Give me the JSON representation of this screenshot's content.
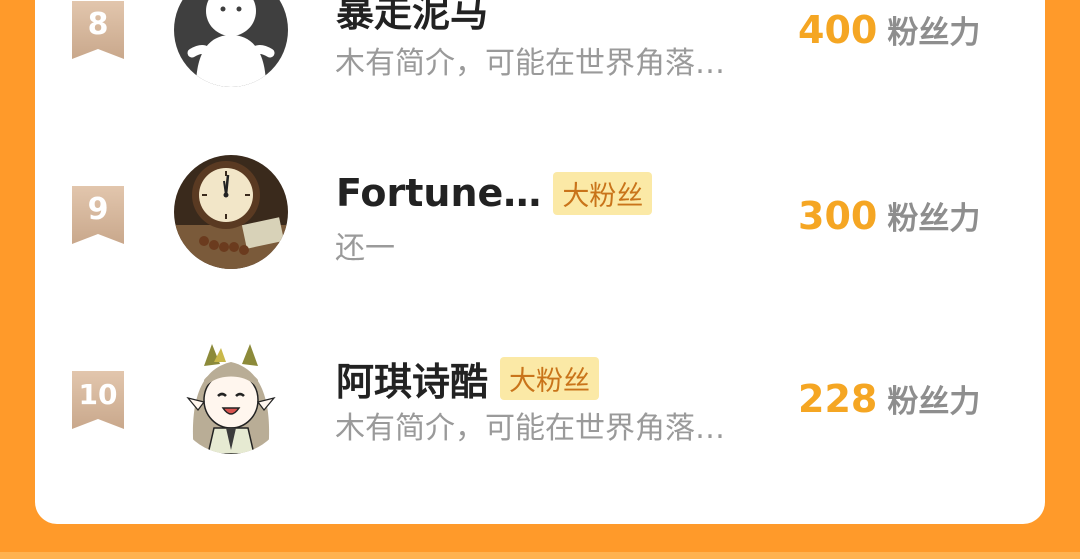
{
  "ranking": {
    "rows": [
      {
        "rank": "8",
        "name": "暴走泥马",
        "bio": "木有简介，可能在世界角落…",
        "score": "400",
        "score_unit": "粉丝力",
        "badge": "",
        "avatar_icon": "default-person-avatar"
      },
      {
        "rank": "9",
        "name": "Fortune…",
        "bio": "还一",
        "score": "300",
        "score_unit": "粉丝力",
        "badge": "大粉丝",
        "avatar_icon": "clock-photo-avatar"
      },
      {
        "rank": "10",
        "name": "阿琪诗酷",
        "bio": "木有简介，可能在世界角落…",
        "score": "228",
        "score_unit": "粉丝力",
        "badge": "大粉丝",
        "avatar_icon": "anime-girl-avatar"
      }
    ]
  },
  "colors": {
    "page_bg": "#ff9a2a",
    "card_bg": "#ffffff",
    "score": "#f5a623",
    "badge_bg": "#fbe9a6",
    "badge_text": "#c9741a",
    "rank_ribbon": "#d6b79c"
  }
}
